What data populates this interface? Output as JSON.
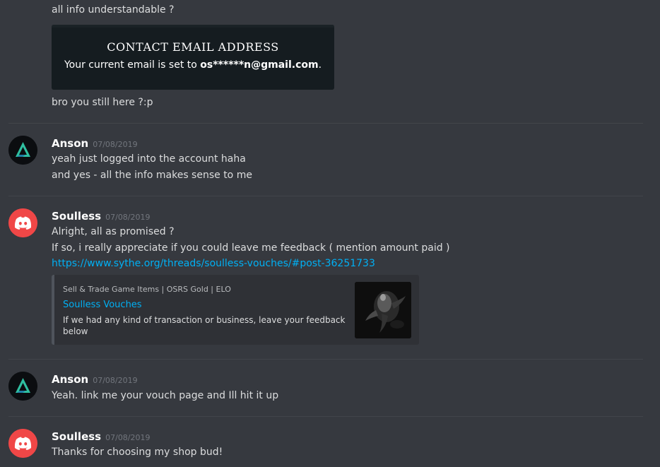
{
  "messages_top": {
    "line1": "all info understandable ?",
    "email_image": {
      "heading": "CONTACT EMAIL ADDRESS",
      "text_prefix": "Your current email is set to ",
      "email": "os******n@gmail.com",
      "text_suffix": "."
    },
    "line2": "bro you still here ?:p"
  },
  "group_anson_1": {
    "username": "Anson",
    "timestamp": "07/08/2019",
    "lines": [
      "yeah just logged into the account haha",
      "and yes - all the info makes sense to me"
    ]
  },
  "group_soulless_1": {
    "username": "Soulless",
    "timestamp": "07/08/2019",
    "lines": [
      "Alright, all as promised ?",
      "If so, i really appreciate if you could leave me feedback ( mention amount paid )"
    ],
    "link": "https://www.sythe.org/threads/soulless-vouches/#post-36251733",
    "embed": {
      "provider": "Sell & Trade Game Items | OSRS Gold | ELO",
      "title": "Soulless Vouches",
      "description": "If we had any kind of transaction or business, leave your feedback below"
    }
  },
  "group_anson_2": {
    "username": "Anson",
    "timestamp": "07/08/2019",
    "lines": [
      "Yeah. link me your vouch page and Ill hit it up"
    ]
  },
  "group_soulless_2": {
    "username": "Soulless",
    "timestamp": "07/08/2019",
    "lines": [
      "Thanks for choosing my shop bud!"
    ]
  },
  "icons": {
    "anson_avatar": "triangle-logo-icon",
    "soulless_avatar": "discord-logo-icon"
  },
  "colors": {
    "background": "#36393f",
    "link": "#00b0f4",
    "soulless_avatar_bg": "#f04747",
    "anson_avatar_accent": "#2fbfa0"
  }
}
